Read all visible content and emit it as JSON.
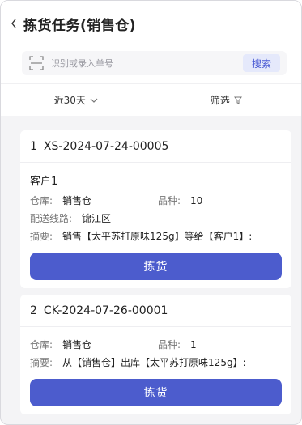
{
  "header": {
    "title": "拣货任务(销售仓)"
  },
  "search": {
    "placeholder": "识别或录入单号",
    "button_label": "搜索"
  },
  "filters": {
    "date_label": "近30天",
    "filter_label": "筛选"
  },
  "tasks": [
    {
      "index": "1",
      "order_no": "XS-2024-07-24-00005",
      "customer": "客户1",
      "warehouse_label": "仓库:",
      "warehouse": "销售仓",
      "variety_label": "品种:",
      "variety": "10",
      "route_label": "配送线路:",
      "route": "锦江区",
      "summary_label": "摘要:",
      "summary": "销售【太平苏打原味125g】等给【客户1】:",
      "button_label": "拣货"
    },
    {
      "index": "2",
      "order_no": "CK-2024-07-26-00001",
      "warehouse_label": "仓库:",
      "warehouse": "销售仓",
      "variety_label": "品种:",
      "variety": "1",
      "summary_label": "摘要:",
      "summary": "从【销售仓】出库【太平苏打原味125g】:",
      "button_label": "拣货"
    }
  ],
  "colors": {
    "primary": "#4c5ccd",
    "search_bg": "#e5e9fb",
    "page_bg": "#f4f4f6"
  }
}
